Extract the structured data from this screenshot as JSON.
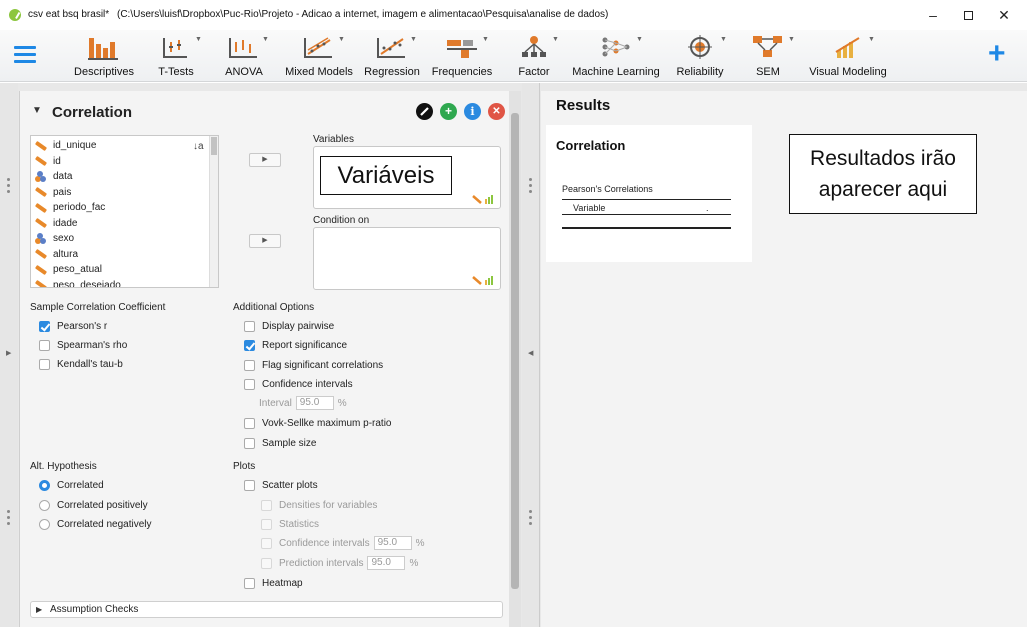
{
  "window": {
    "app_name": "csv eat bsq brasil*",
    "file_path": "(C:\\Users\\luisf\\Dropbox\\Puc-Rio\\Projeto - Adicao a internet, imagem e alimentacao\\Pesquisa\\analise de dados)",
    "minimize": "–",
    "close": "✕"
  },
  "ribbon": {
    "items": [
      {
        "label": "Descriptives",
        "icon": "descriptives-icon"
      },
      {
        "label": "T-Tests",
        "icon": "t-tests-icon"
      },
      {
        "label": "ANOVA",
        "icon": "anova-icon"
      },
      {
        "label": "Mixed Models",
        "icon": "mixed-models-icon"
      },
      {
        "label": "Regression",
        "icon": "regression-icon"
      },
      {
        "label": "Frequencies",
        "icon": "frequencies-icon"
      },
      {
        "label": "Factor",
        "icon": "factor-icon"
      },
      {
        "label": "Machine Learning",
        "icon": "machine-learning-icon"
      },
      {
        "label": "Reliability",
        "icon": "reliability-icon"
      },
      {
        "label": "SEM",
        "icon": "sem-icon"
      },
      {
        "label": "Visual Modeling",
        "icon": "visual-modeling-icon"
      }
    ],
    "plus": "+"
  },
  "analysis": {
    "title": "Correlation",
    "variables_label": "Variables",
    "condition_label": "Condition on",
    "variables_annotation": "Variáveis",
    "variable_list": [
      {
        "name": "id_unique",
        "type": "scale"
      },
      {
        "name": "id",
        "type": "scale"
      },
      {
        "name": "data",
        "type": "nominal"
      },
      {
        "name": "pais",
        "type": "scale"
      },
      {
        "name": "periodo_fac",
        "type": "scale"
      },
      {
        "name": "idade",
        "type": "scale"
      },
      {
        "name": "sexo",
        "type": "nominal"
      },
      {
        "name": "altura",
        "type": "scale"
      },
      {
        "name": "peso_atual",
        "type": "scale"
      },
      {
        "name": "peso_desejado",
        "type": "scale"
      }
    ],
    "coefficient": {
      "title": "Sample Correlation Coefficient",
      "options": [
        {
          "label": "Pearson's r",
          "checked": true
        },
        {
          "label": "Spearman's rho",
          "checked": false
        },
        {
          "label": "Kendall's tau-b",
          "checked": false
        }
      ]
    },
    "additional": {
      "title": "Additional Options",
      "display_pairwise": "Display pairwise",
      "report_significance": "Report significance",
      "flag_significant": "Flag significant correlations",
      "confidence_intervals": "Confidence intervals",
      "interval_label": "Interval",
      "interval_value": "95.0",
      "percent": "%",
      "vovk_sellke": "Vovk-Sellke maximum p-ratio",
      "sample_size": "Sample size"
    },
    "hypothesis": {
      "title": "Alt. Hypothesis",
      "options": [
        {
          "label": "Correlated",
          "checked": true
        },
        {
          "label": "Correlated positively",
          "checked": false
        },
        {
          "label": "Correlated negatively",
          "checked": false
        }
      ]
    },
    "plots": {
      "title": "Plots",
      "scatter": "Scatter plots",
      "densities": "Densities for variables",
      "statistics": "Statistics",
      "conf_intervals": "Confidence intervals",
      "conf_value": "95.0",
      "pred_intervals": "Prediction intervals",
      "pred_value": "95.0",
      "percent": "%",
      "heatmap": "Heatmap"
    },
    "assumption_checks": "Assumption Checks"
  },
  "results": {
    "title": "Results",
    "subtitle": "Correlation",
    "table_title": "Pearson's Correlations",
    "column_header": "Variable",
    "dot": ".",
    "annotation": "Resultados irão aparecer aqui"
  },
  "colors": {
    "accent": "#1e88e5",
    "scale_icon": "#e8892a",
    "check": "#2b8ae0"
  }
}
